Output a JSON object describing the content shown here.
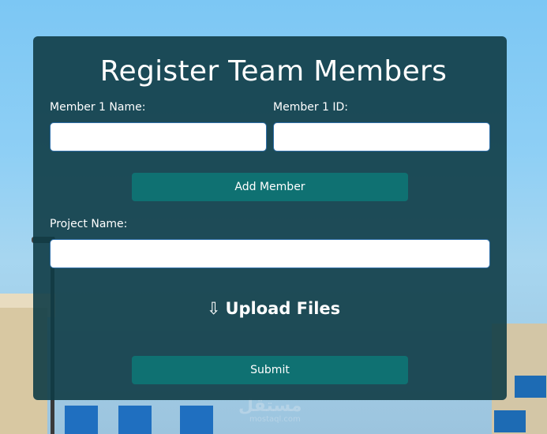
{
  "form": {
    "title": "Register Team Members",
    "member1_name_label": "Member 1 Name:",
    "member1_name_value": "",
    "member1_id_label": "Member 1 ID:",
    "member1_id_value": "",
    "add_member_label": "Add Member",
    "project_name_label": "Project Name:",
    "project_name_value": "",
    "upload_label": "Upload Files",
    "upload_icon": "⇩",
    "submit_label": "Submit"
  },
  "background": {
    "watermark_text": "مستقل",
    "watermark_sub": "mostaql.com"
  },
  "colors": {
    "card_bg": "#103c46",
    "button_bg": "#0f7172",
    "input_border": "#2f6fa8",
    "text": "#ffffff"
  }
}
